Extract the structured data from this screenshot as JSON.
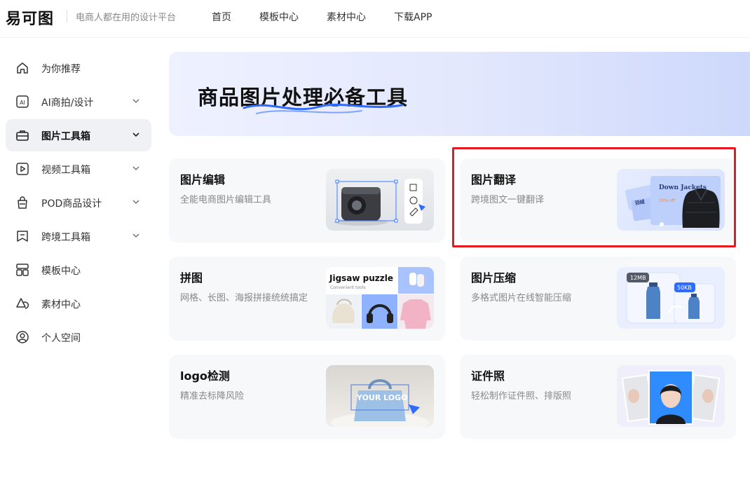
{
  "header": {
    "logo": "易可图",
    "slogan": "电商人都在用的设计平台",
    "nav": [
      "首页",
      "模板中心",
      "素材中心",
      "下载APP"
    ]
  },
  "sidebar": {
    "items": [
      {
        "label": "为你推荐",
        "icon": "home-icon",
        "chevron": false
      },
      {
        "label": "AI商拍/设计",
        "icon": "ai-icon",
        "chevron": true
      },
      {
        "label": "图片工具箱",
        "icon": "toolbox-icon",
        "chevron": true,
        "active": true
      },
      {
        "label": "视频工具箱",
        "icon": "video-icon",
        "chevron": true
      },
      {
        "label": "POD商品设计",
        "icon": "bag-icon",
        "chevron": true
      },
      {
        "label": "跨境工具箱",
        "icon": "bookmark-icon",
        "chevron": true
      },
      {
        "label": "模板中心",
        "icon": "layout-icon",
        "chevron": false
      },
      {
        "label": "素材中心",
        "icon": "shapes-icon",
        "chevron": false
      },
      {
        "label": "个人空间",
        "icon": "user-icon",
        "chevron": false
      }
    ]
  },
  "banner": {
    "title": "商品图片处理必备工具"
  },
  "cards": [
    {
      "title": "图片编辑",
      "desc": "全能电商图片编辑工具"
    },
    {
      "title": "图片翻译",
      "desc": "跨境图文一键翻译",
      "highlighted": true
    },
    {
      "title": "拼图",
      "desc": "网格、长图、海报拼接统统搞定"
    },
    {
      "title": "图片压缩",
      "desc": "多格式图片在线智能压缩"
    },
    {
      "title": "logo检测",
      "desc": "精准去标降风险"
    },
    {
      "title": "证件照",
      "desc": "轻松制作证件照、排版照"
    }
  ],
  "thumbs": {
    "translate_text": "Down Jackets",
    "translate_sub": "30% off",
    "translate_cn": "羽绒",
    "jigsaw_title": "Jigsaw puzzle",
    "jigsaw_sub": "Convenient tools",
    "compress_before": "12MB",
    "compress_after": "50KB",
    "logo_text": "YOUR LOGO"
  },
  "colors": {
    "accent": "#2f6bff",
    "highlight_border": "#e5191f",
    "active_bg": "#eff1f5",
    "card_bg": "#f7f8fa"
  }
}
